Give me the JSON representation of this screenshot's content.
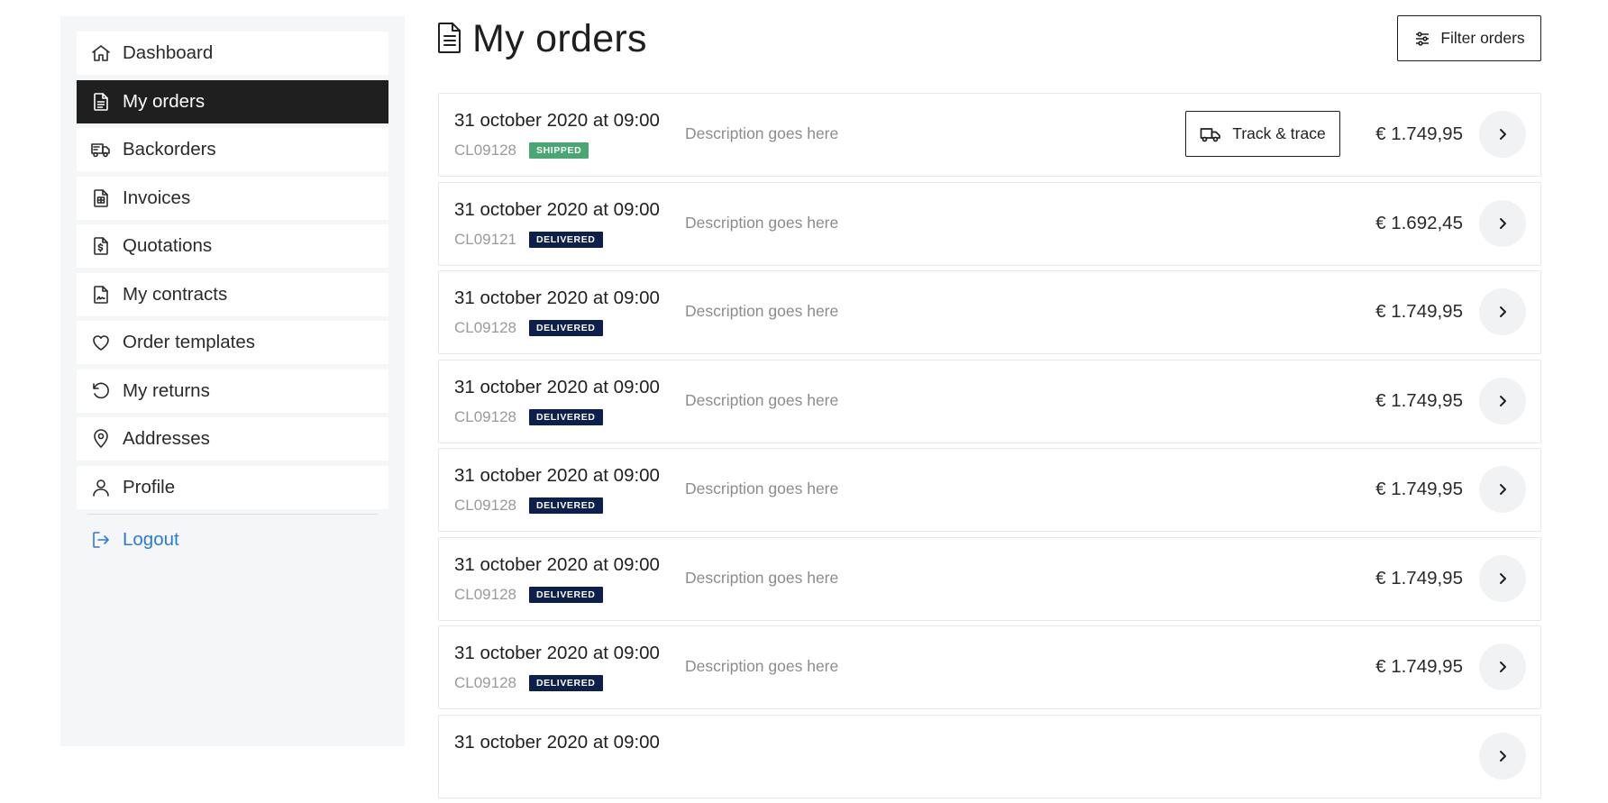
{
  "page": {
    "title": "My orders",
    "filter_label": "Filter orders"
  },
  "sidebar": {
    "items": [
      {
        "label": "Dashboard",
        "icon": "home-icon",
        "active": false
      },
      {
        "label": "My orders",
        "icon": "document-icon",
        "active": true
      },
      {
        "label": "Backorders",
        "icon": "truck-icon",
        "active": false
      },
      {
        "label": "Invoices",
        "icon": "invoice-icon",
        "active": false
      },
      {
        "label": "Quotations",
        "icon": "quotation-icon",
        "active": false
      },
      {
        "label": "My contracts",
        "icon": "contract-icon",
        "active": false
      },
      {
        "label": "Order templates",
        "icon": "heart-icon",
        "active": false
      },
      {
        "label": "My returns",
        "icon": "return-icon",
        "active": false
      },
      {
        "label": "Addresses",
        "icon": "location-pin-icon",
        "active": false
      },
      {
        "label": "Profile",
        "icon": "user-icon",
        "active": false
      }
    ],
    "logout_label": "Logout"
  },
  "colors": {
    "active_bg": "#1f1f1f",
    "shipped": "#4aa774",
    "delivered": "#0c1f4d",
    "logout": "#2a7ad6"
  },
  "orders": [
    {
      "date": "31 october 2020 at 09:00",
      "id": "CL09128",
      "status": "SHIPPED",
      "description": "Description goes here",
      "price": "€ 1.749,95",
      "track_label": "Track & trace"
    },
    {
      "date": "31 october 2020 at 09:00",
      "id": "CL09121",
      "status": "DELIVERED",
      "description": "Description goes here",
      "price": "€ 1.692,45"
    },
    {
      "date": "31 october 2020 at 09:00",
      "id": "CL09128",
      "status": "DELIVERED",
      "description": "Description goes here",
      "price": "€ 1.749,95"
    },
    {
      "date": "31 october 2020 at 09:00",
      "id": "CL09128",
      "status": "DELIVERED",
      "description": "Description goes here",
      "price": "€ 1.749,95"
    },
    {
      "date": "31 october 2020 at 09:00",
      "id": "CL09128",
      "status": "DELIVERED",
      "description": "Description goes here",
      "price": "€ 1.749,95"
    },
    {
      "date": "31 october 2020 at 09:00",
      "id": "CL09128",
      "status": "DELIVERED",
      "description": "Description goes here",
      "price": "€ 1.749,95"
    },
    {
      "date": "31 october 2020 at 09:00",
      "id": "CL09128",
      "status": "DELIVERED",
      "description": "Description goes here",
      "price": "€ 1.749,95"
    },
    {
      "date": "31 october 2020 at 09:00"
    }
  ]
}
